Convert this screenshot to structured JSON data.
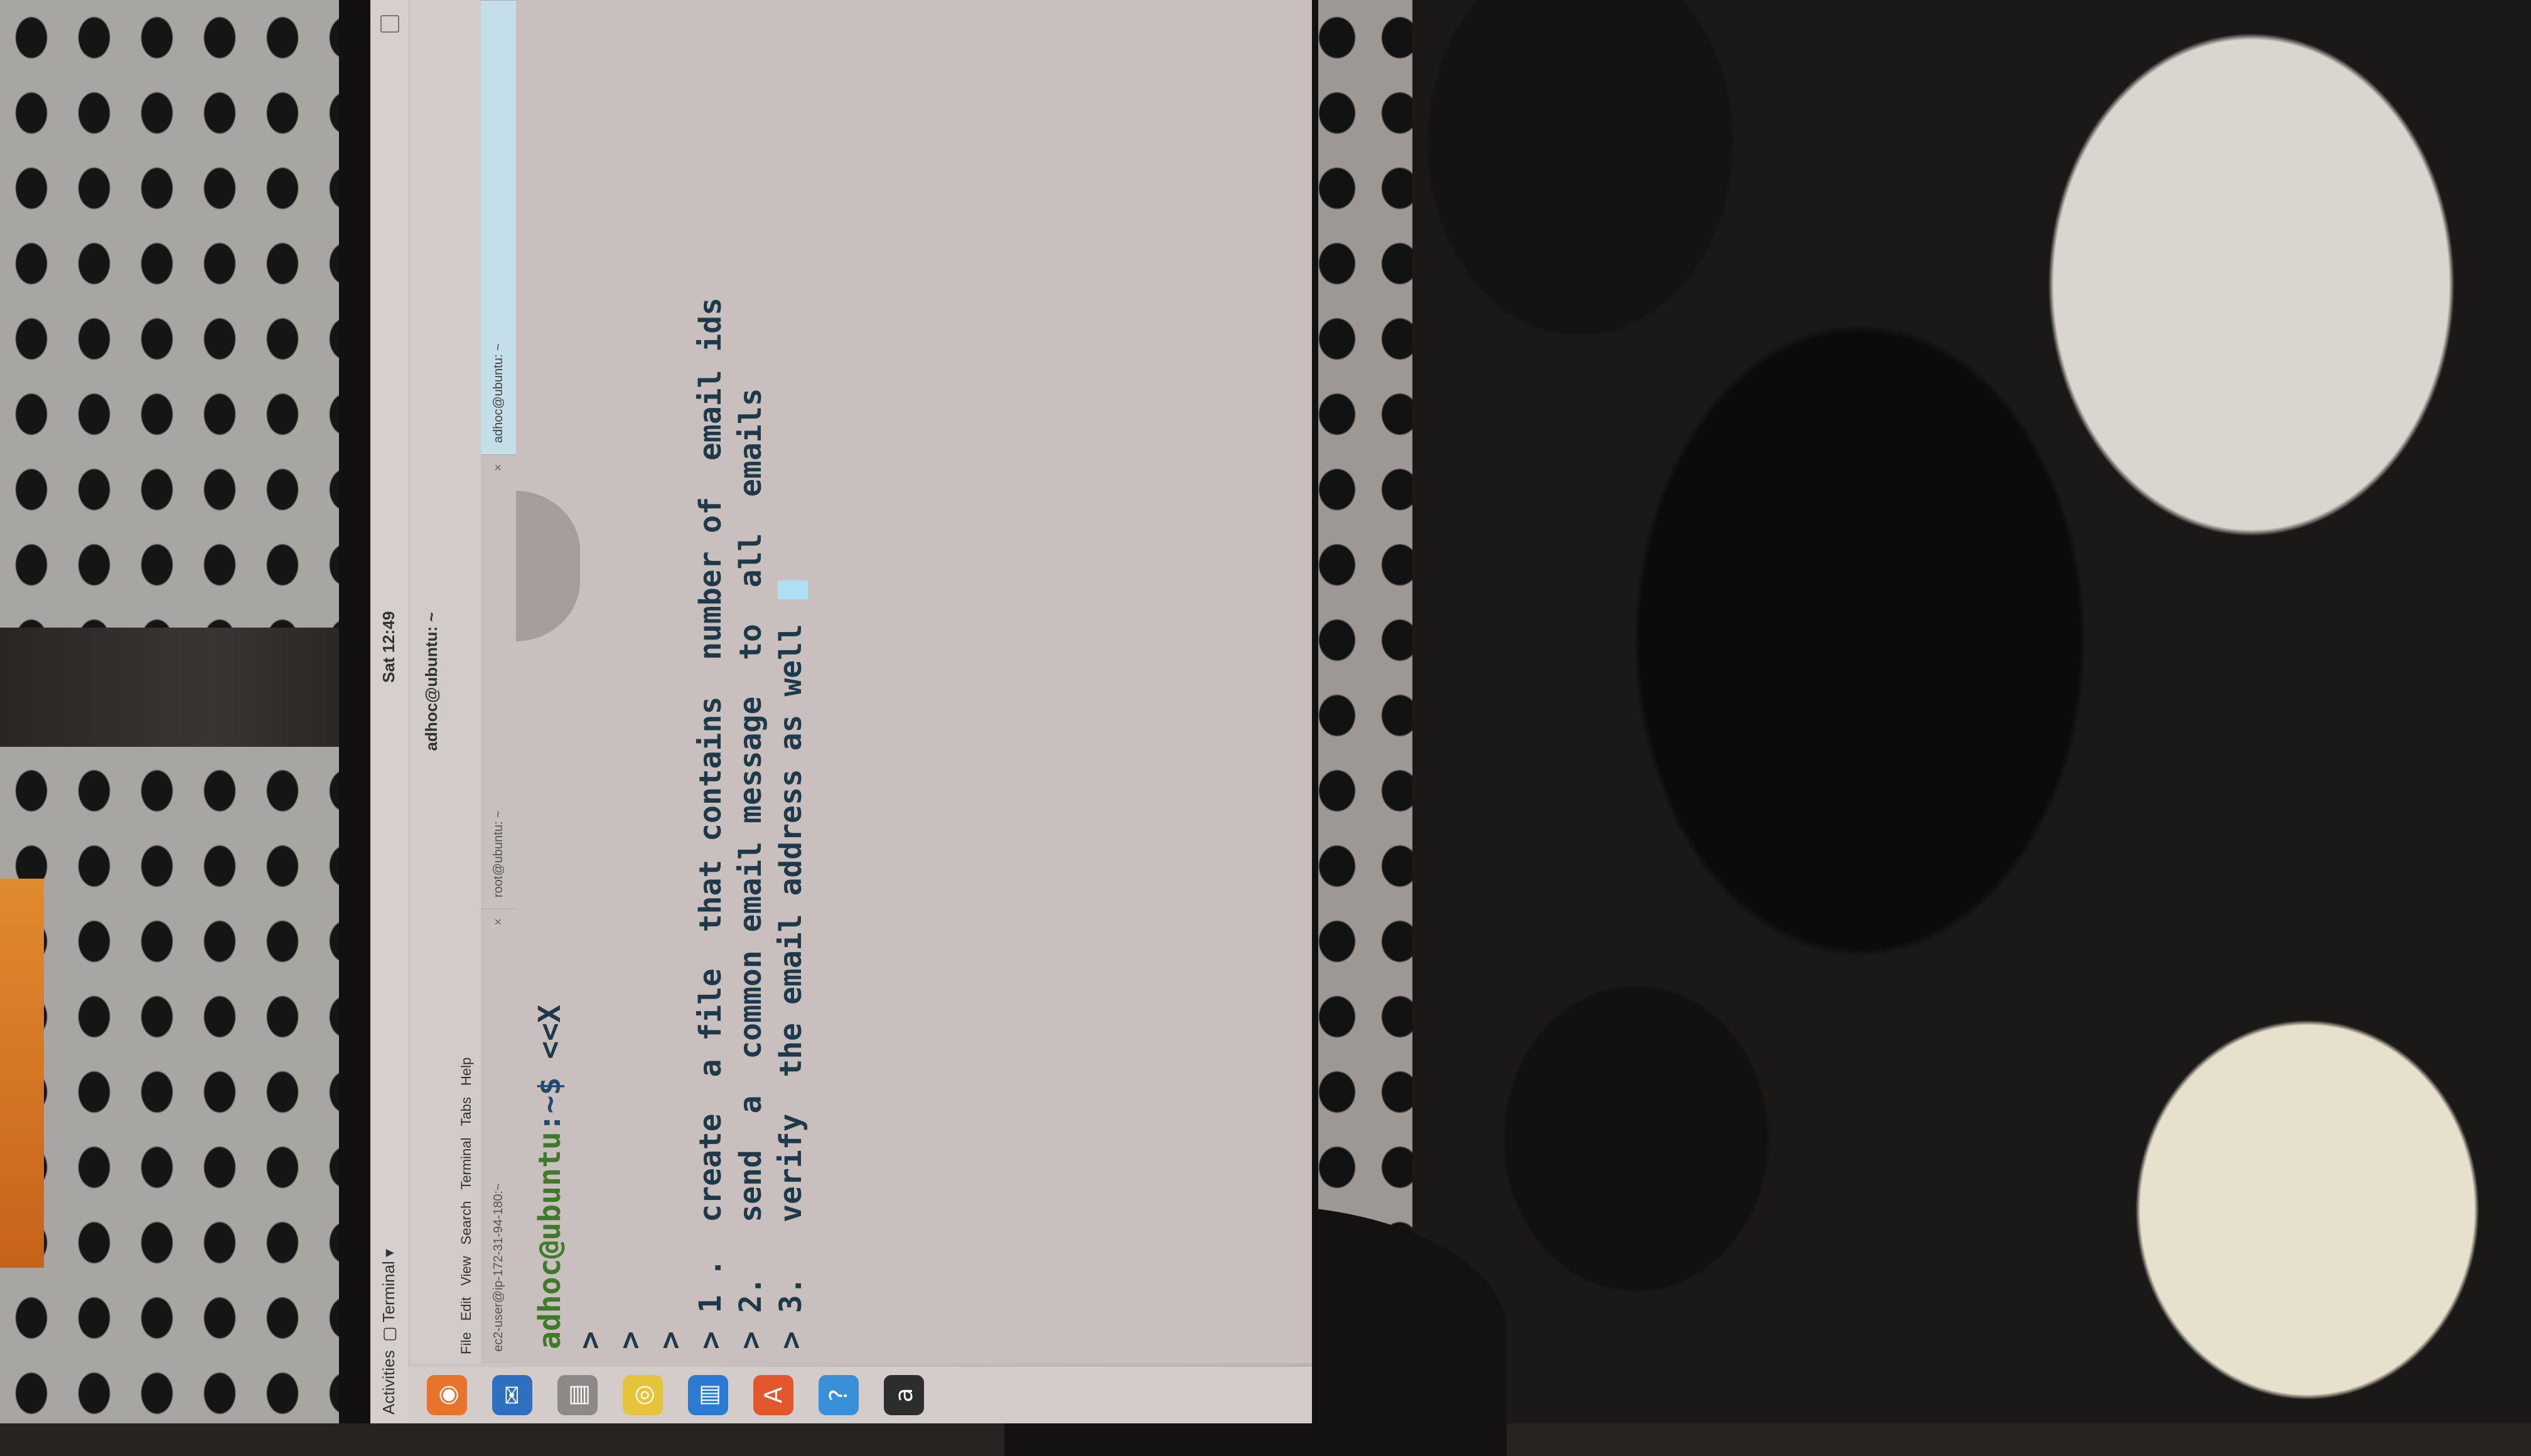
{
  "topbar": {
    "activities": "Activities",
    "app_menu": "Terminal",
    "clock": "Sat 12:49"
  },
  "dock": {
    "items": [
      {
        "icon": "firefox-icon"
      },
      {
        "icon": "thunderbird-icon"
      },
      {
        "icon": "files-icon"
      },
      {
        "icon": "rhythmbox-icon"
      },
      {
        "icon": "libreoffice-writer-icon"
      },
      {
        "icon": "software-center-icon"
      },
      {
        "icon": "help-icon"
      },
      {
        "icon": "amazon-icon"
      }
    ]
  },
  "window": {
    "title": "adhoc@ubuntu: ~",
    "menu": [
      "File",
      "Edit",
      "View",
      "Search",
      "Terminal",
      "Tabs",
      "Help"
    ],
    "tabs": [
      {
        "label": "ec2-user@ip-172-31-94-180:~",
        "active": false
      },
      {
        "label": "root@ubuntu: ~",
        "active": false
      },
      {
        "label": "adhoc@ubuntu: ~",
        "active": true
      }
    ]
  },
  "terminal": {
    "prompt_user": "adhoc@ubuntu",
    "prompt_path": ":~$",
    "command": " <<X",
    "lines": [
      ">",
      ">",
      ">",
      "> 1 .  create  a file  that contains  number of  email ids",
      "> 2.   send  a  common email message  to  all  emails",
      "> 3.   verify  the email address as well "
    ]
  },
  "colors": {
    "prompt_user": "#3d7a2a",
    "prompt_path": "#1e4a70",
    "cursor": "#aee0f2",
    "active_tab": "#c4dfe9"
  }
}
